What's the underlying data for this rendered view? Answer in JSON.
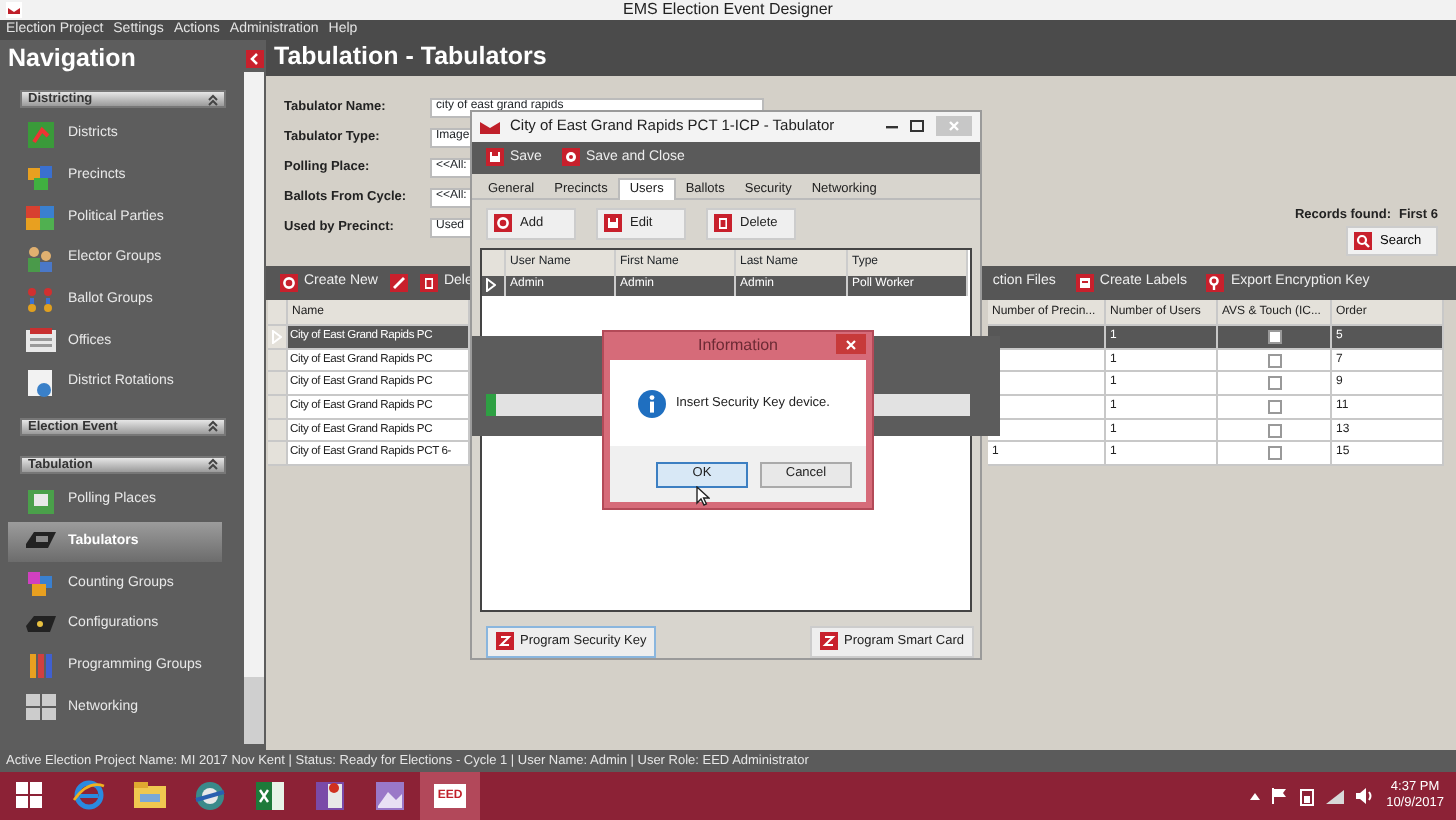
{
  "window": {
    "title": "EMS Election Event Designer"
  },
  "menu": [
    "Election Project",
    "Settings",
    "Actions",
    "Administration",
    "Help"
  ],
  "navigation": {
    "title": "Navigation",
    "sections": [
      {
        "title": "Districting",
        "items": [
          {
            "label": "Districts",
            "selected": false
          },
          {
            "label": "Precincts",
            "selected": false
          },
          {
            "label": "Political Parties",
            "selected": false
          },
          {
            "label": "Elector Groups",
            "selected": false
          },
          {
            "label": "Ballot Groups",
            "selected": false
          },
          {
            "label": "Offices",
            "selected": false
          },
          {
            "label": "District Rotations",
            "selected": false
          }
        ]
      },
      {
        "title": "Election Event"
      },
      {
        "title": "Tabulation",
        "items": [
          {
            "label": "Polling Places",
            "selected": false
          },
          {
            "label": "Tabulators",
            "selected": true
          },
          {
            "label": "Counting Groups",
            "selected": false
          },
          {
            "label": "Configurations",
            "selected": false
          },
          {
            "label": "Programming Groups",
            "selected": false
          },
          {
            "label": "Networking",
            "selected": false
          }
        ]
      }
    ]
  },
  "page": {
    "title": "Tabulation - Tabulators",
    "filters": [
      {
        "label": "Tabulator Name:",
        "value": "city of east grand rapids"
      },
      {
        "label": "Tabulator Type:",
        "value": "Image"
      },
      {
        "label": "Polling Place:",
        "value": "<<All:"
      },
      {
        "label": "Ballots From Cycle:",
        "value": "<<All:"
      },
      {
        "label": "Used by Precinct:",
        "value": "Used"
      }
    ],
    "records_label": "Records found:",
    "records_value": "First 6",
    "search_button": "Search"
  },
  "toolbar": [
    {
      "kind": "add",
      "label": "Create New"
    },
    {
      "kind": "edit"
    },
    {
      "kind": "delete",
      "label": "Dele"
    },
    {
      "kind": "text",
      "label": "ction Files"
    },
    {
      "kind": "label",
      "label": "Create Labels"
    },
    {
      "kind": "key",
      "label": "Export Encryption Key"
    }
  ],
  "table": {
    "columns": [
      "Name",
      "Number of Precin...",
      "Number of Users",
      "AVS & Touch (IC...",
      "Order"
    ],
    "rows": [
      {
        "name": "City of East Grand Rapids PC",
        "users": "1",
        "avs_touch": false,
        "order": "5",
        "selected": true
      },
      {
        "name": "City of East Grand Rapids PC",
        "users": "1",
        "avs_touch": false,
        "order": "7",
        "selected": false
      },
      {
        "name": "City of East Grand Rapids PC",
        "users": "1",
        "avs_touch": false,
        "order": "9",
        "selected": false
      },
      {
        "name": "City of East Grand Rapids PC",
        "users": "1",
        "avs_touch": false,
        "order": "11",
        "selected": false
      },
      {
        "name": "City of East Grand Rapids PC",
        "users": "1",
        "avs_touch": false,
        "order": "13",
        "selected": false
      },
      {
        "name": "City of East Grand Rapids PCT 6-",
        "precincts": "1",
        "users": "1",
        "avs_touch": false,
        "order": "15",
        "selected": false
      }
    ]
  },
  "tabulator_dialog": {
    "title": "City of East Grand Rapids PCT 1-ICP - Tabulator",
    "actions": [
      "Save",
      "Save and Close"
    ],
    "tabs": [
      {
        "label": "General",
        "selected": false
      },
      {
        "label": "Precincts",
        "selected": false
      },
      {
        "label": "Users",
        "selected": true
      },
      {
        "label": "Ballots",
        "selected": false
      },
      {
        "label": "Security",
        "selected": false
      },
      {
        "label": "Networking",
        "selected": false
      }
    ],
    "buttons": [
      "Add",
      "Edit",
      "Delete"
    ],
    "columns": [
      "User Name",
      "First Name",
      "Last Name",
      "Type"
    ],
    "rows": [
      {
        "cells": [
          "Admin",
          "Admin",
          "Admin",
          "Poll Worker"
        ],
        "selected": true
      }
    ],
    "footer_buttons": [
      "Program Security Key",
      "Program Smart Card"
    ]
  },
  "progress": {
    "level": 0.02
  },
  "info_dialog": {
    "title": "Information",
    "message": "Insert Security Key device.",
    "buttons": [
      {
        "label": "OK",
        "focused": true
      },
      {
        "label": "Cancel",
        "focused": false
      }
    ]
  },
  "status_bar": "Active Election Project Name: MI 2017 Nov Kent | Status: Ready for Elections - Cycle 1 | User Name: Admin | User Role: EED Administrator",
  "taskbar": {
    "active_app_label": "EED",
    "time": "4:37 PM",
    "date": "10/9/2017"
  }
}
